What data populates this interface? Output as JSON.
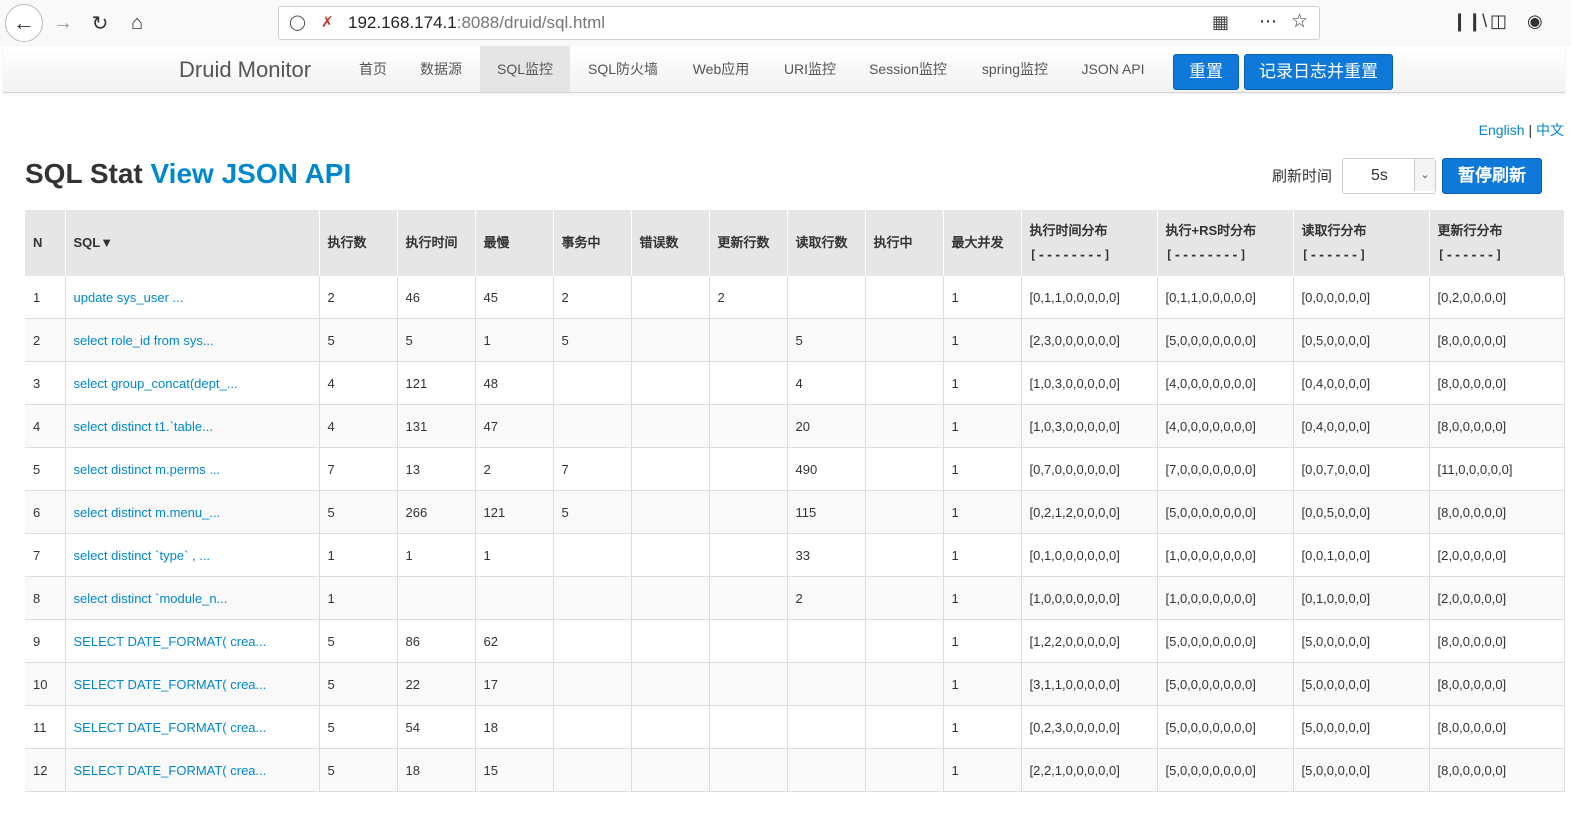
{
  "browser": {
    "url_host": "192.168.174.1",
    "url_rest": ":8088/druid/sql.html"
  },
  "nav": {
    "brand": "Druid Monitor",
    "items": [
      "首页",
      "数据源",
      "SQL监控",
      "SQL防火墙",
      "Web应用",
      "URI监控",
      "Session监控",
      "spring监控",
      "JSON API"
    ],
    "reset_label": "重置",
    "log_reset_label": "记录日志并重置"
  },
  "lang": {
    "en": "English",
    "sep": "|",
    "zh": "中文"
  },
  "page": {
    "title": "SQL Stat",
    "title_link": "View JSON API",
    "refresh_label": "刷新时间",
    "refresh_value": "5s",
    "pause_label": "暂停刷新"
  },
  "table": {
    "headers": {
      "n": "N",
      "sql": "SQL▼",
      "exec_count": "执行数",
      "exec_time": "执行时间",
      "slowest": "最慢",
      "in_tx": "事务中",
      "errors": "错误数",
      "update_rows": "更新行数",
      "read_rows": "读取行数",
      "running": "执行中",
      "max_concurrent": "最大并发",
      "exec_hist": "执行时间分布",
      "exec_hist_b": "[--------]",
      "exec_rs_hist": "执行+RS时分布",
      "exec_rs_hist_b": "[--------]",
      "read_hist": "读取行分布",
      "read_hist_b": "[------]",
      "update_hist": "更新行分布",
      "update_hist_b": "[------]"
    },
    "rows": [
      [
        "1",
        "update sys_user ...",
        "2",
        "46",
        "45",
        "2",
        "",
        "2",
        "",
        "",
        "1",
        "[0,1,1,0,0,0,0,0]",
        "[0,1,1,0,0,0,0,0]",
        "[0,0,0,0,0,0]",
        "[0,2,0,0,0,0]"
      ],
      [
        "2",
        "select role_id from sys...",
        "5",
        "5",
        "1",
        "5",
        "",
        "",
        "5",
        "",
        "1",
        "[2,3,0,0,0,0,0,0]",
        "[5,0,0,0,0,0,0,0]",
        "[0,5,0,0,0,0]",
        "[8,0,0,0,0,0]"
      ],
      [
        "3",
        "select group_concat(dept_...",
        "4",
        "121",
        "48",
        "",
        "",
        "",
        "4",
        "",
        "1",
        "[1,0,3,0,0,0,0,0]",
        "[4,0,0,0,0,0,0,0]",
        "[0,4,0,0,0,0]",
        "[8,0,0,0,0,0]"
      ],
      [
        "4",
        "select distinct t1.`table...",
        "4",
        "131",
        "47",
        "",
        "",
        "",
        "20",
        "",
        "1",
        "[1,0,3,0,0,0,0,0]",
        "[4,0,0,0,0,0,0,0]",
        "[0,4,0,0,0,0]",
        "[8,0,0,0,0,0]"
      ],
      [
        "5",
        "select distinct m.perms ...",
        "7",
        "13",
        "2",
        "7",
        "",
        "",
        "490",
        "",
        "1",
        "[0,7,0,0,0,0,0,0]",
        "[7,0,0,0,0,0,0,0]",
        "[0,0,7,0,0,0]",
        "[11,0,0,0,0,0]"
      ],
      [
        "6",
        "select distinct m.menu_...",
        "5",
        "266",
        "121",
        "5",
        "",
        "",
        "115",
        "",
        "1",
        "[0,2,1,2,0,0,0,0]",
        "[5,0,0,0,0,0,0,0]",
        "[0,0,5,0,0,0]",
        "[8,0,0,0,0,0]"
      ],
      [
        "7",
        "select distinct `type` , ...",
        "1",
        "1",
        "1",
        "",
        "",
        "",
        "33",
        "",
        "1",
        "[0,1,0,0,0,0,0,0]",
        "[1,0,0,0,0,0,0,0]",
        "[0,0,1,0,0,0]",
        "[2,0,0,0,0,0]"
      ],
      [
        "8",
        "select distinct `module_n...",
        "1",
        "",
        "",
        "",
        "",
        "",
        "2",
        "",
        "1",
        "[1,0,0,0,0,0,0,0]",
        "[1,0,0,0,0,0,0,0]",
        "[0,1,0,0,0,0]",
        "[2,0,0,0,0,0]"
      ],
      [
        "9",
        "SELECT DATE_FORMAT( crea...",
        "5",
        "86",
        "62",
        "",
        "",
        "",
        "",
        "",
        "1",
        "[1,2,2,0,0,0,0,0]",
        "[5,0,0,0,0,0,0,0]",
        "[5,0,0,0,0,0]",
        "[8,0,0,0,0,0]"
      ],
      [
        "10",
        "SELECT DATE_FORMAT( crea...",
        "5",
        "22",
        "17",
        "",
        "",
        "",
        "",
        "",
        "1",
        "[3,1,1,0,0,0,0,0]",
        "[5,0,0,0,0,0,0,0]",
        "[5,0,0,0,0,0]",
        "[8,0,0,0,0,0]"
      ],
      [
        "11",
        "SELECT DATE_FORMAT( crea...",
        "5",
        "54",
        "18",
        "",
        "",
        "",
        "",
        "",
        "1",
        "[0,2,3,0,0,0,0,0]",
        "[5,0,0,0,0,0,0,0]",
        "[5,0,0,0,0,0]",
        "[8,0,0,0,0,0]"
      ],
      [
        "12",
        "SELECT DATE_FORMAT( crea...",
        "5",
        "18",
        "15",
        "",
        "",
        "",
        "",
        "",
        "1",
        "[2,2,1,0,0,0,0,0]",
        "[5,0,0,0,0,0,0,0]",
        "[5,0,0,0,0,0]",
        "[8,0,0,0,0,0]"
      ]
    ]
  }
}
